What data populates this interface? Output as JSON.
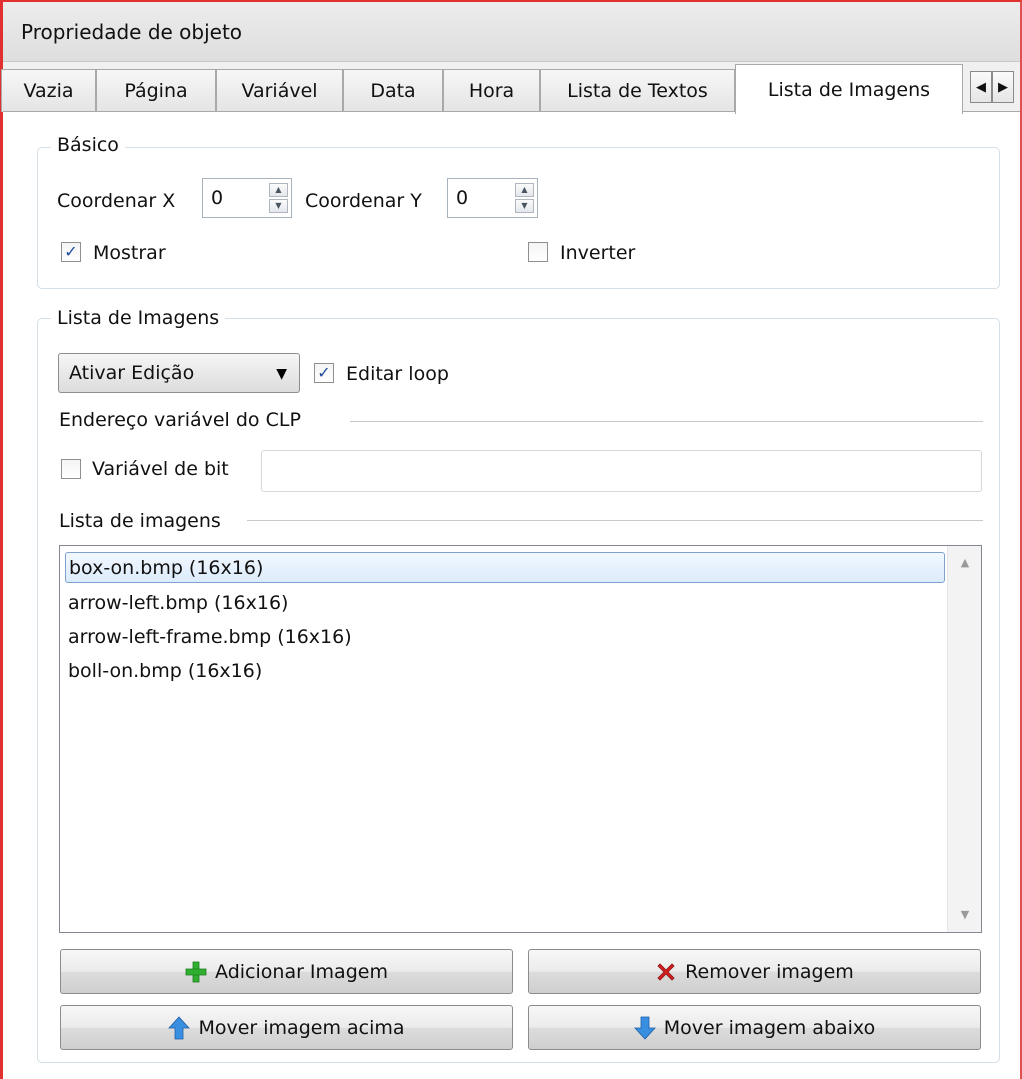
{
  "window": {
    "title": "Propriedade de objeto"
  },
  "tabs": [
    {
      "label": "Vazia"
    },
    {
      "label": "Página"
    },
    {
      "label": "Variável"
    },
    {
      "label": "Data"
    },
    {
      "label": "Hora"
    },
    {
      "label": "Lista de Textos"
    },
    {
      "label": "Lista de Imagens",
      "active": true
    }
  ],
  "tab_scroll": {
    "left_icon": "triangle-left-icon",
    "right_icon": "triangle-right-icon"
  },
  "basico": {
    "title": "Básico",
    "coord_x_label": "Coordenar X",
    "coord_x_value": "0",
    "coord_y_label": "Coordenar Y",
    "coord_y_value": "0",
    "mostrar_label": "Mostrar",
    "mostrar_checked": true,
    "inverter_label": "Inverter",
    "inverter_checked": false
  },
  "lista_imagens_group": {
    "title": "Lista de Imagens",
    "mode_select": "Ativar Edição",
    "editar_loop_label": "Editar loop",
    "editar_loop_checked": true,
    "endereco_label": "Endereço variável do CLP",
    "variavel_bit_label": "Variável de bit",
    "variavel_bit_checked": false,
    "variavel_bit_value": "",
    "lista_label": "Lista de imagens",
    "items": [
      "box-on.bmp (16x16)",
      "arrow-left.bmp (16x16)",
      "arrow-left-frame.bmp (16x16)",
      "boll-on.bmp (16x16)"
    ],
    "selected_index": 0
  },
  "buttons": {
    "add": "Adicionar Imagem",
    "remove": "Remover imagem",
    "up": "Mover imagem acima",
    "down": "Mover imagem abaixo"
  },
  "colors": {
    "add_icon": "#2fae2f",
    "remove_icon": "#d32020",
    "arrow_icon": "#3a8ee0",
    "selection": "#dcebfc"
  }
}
